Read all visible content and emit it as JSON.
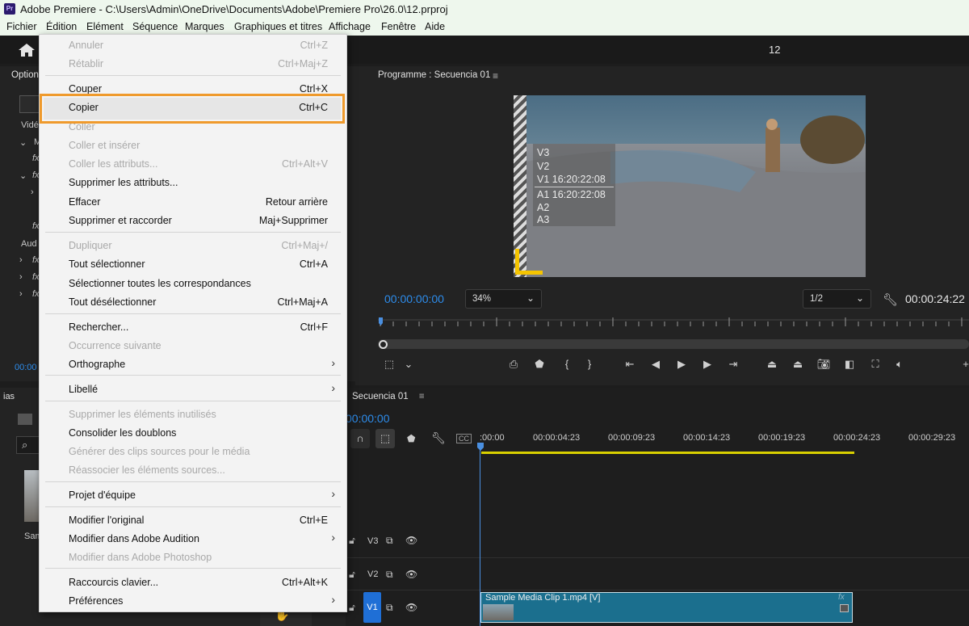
{
  "window": {
    "title": "Adobe Premiere - C:\\Users\\Admin\\OneDrive\\Documents\\Adobe\\Premiere Pro\\26.0\\12.prproj",
    "app_icon": "Pr"
  },
  "menubar": [
    "Fichier",
    "Édition",
    "Elément",
    "Séquence",
    "Marques",
    "Graphiques et titres",
    "Affichage",
    "Fenêtre",
    "Aide"
  ],
  "workspace": {
    "number": "12"
  },
  "left_panel": {
    "tab": "Option",
    "labels": [
      "Vidé",
      "M",
      "fx",
      "fx",
      "fx",
      "Aud",
      "fx",
      "fx",
      "fx"
    ],
    "timecode": "00:00",
    "bottom_tab": "ias",
    "bottom_label": "Sam"
  },
  "program_monitor": {
    "title": "Programme : Secuencia 01",
    "overlay": [
      "V3",
      "V2",
      "V1 16:20:22:08",
      "A1 16:20:22:08",
      "A2",
      "A3"
    ],
    "timecode_current": "00:00:00:00",
    "zoom": "34%",
    "resolution": "1/2",
    "timecode_duration": "00:00:24:22"
  },
  "timeline": {
    "tab": "Secuencia 01",
    "timecode": "00:00:00",
    "ruler": [
      ":00:00",
      "00:00:04:23",
      "00:00:09:23",
      "00:00:14:23",
      "00:00:19:23",
      "00:00:24:23",
      "00:00:29:23"
    ],
    "tracks": [
      "V3",
      "V2",
      "V1"
    ],
    "clip_name": "Sample Media Clip 1.mp4 [V]",
    "clip_fx": "fx"
  },
  "edit_menu": {
    "items": [
      {
        "label": "Annuler",
        "shortcut": "Ctrl+Z",
        "disabled": true
      },
      {
        "label": "Rétablir",
        "shortcut": "Ctrl+Maj+Z",
        "disabled": true
      },
      {
        "label": "Couper",
        "shortcut": "Ctrl+X",
        "disabled": false
      },
      {
        "label": "Copier",
        "shortcut": "Ctrl+C",
        "disabled": false
      },
      {
        "label": "Coller",
        "shortcut": "",
        "disabled": true
      },
      {
        "label": "Coller et insérer",
        "shortcut": "",
        "disabled": true
      },
      {
        "label": "Coller les attributs...",
        "shortcut": "Ctrl+Alt+V",
        "disabled": true
      },
      {
        "label": "Supprimer les attributs...",
        "shortcut": "",
        "disabled": false
      },
      {
        "label": "Effacer",
        "shortcut": "Retour arrière",
        "disabled": false
      },
      {
        "label": "Supprimer et raccorder",
        "shortcut": "Maj+Supprimer",
        "disabled": false
      },
      {
        "label": "Dupliquer",
        "shortcut": "Ctrl+Maj+/",
        "disabled": true
      },
      {
        "label": "Tout sélectionner",
        "shortcut": "Ctrl+A",
        "disabled": false
      },
      {
        "label": "Sélectionner toutes les correspondances",
        "shortcut": "",
        "disabled": false
      },
      {
        "label": "Tout désélectionner",
        "shortcut": "Ctrl+Maj+A",
        "disabled": false
      },
      {
        "label": "Rechercher...",
        "shortcut": "Ctrl+F",
        "disabled": false
      },
      {
        "label": "Occurrence suivante",
        "shortcut": "",
        "disabled": true
      },
      {
        "label": "Orthographe",
        "shortcut": "",
        "disabled": false,
        "submenu": true
      },
      {
        "label": "Libellé",
        "shortcut": "",
        "disabled": false,
        "submenu": true
      },
      {
        "label": "Supprimer les éléments inutilisés",
        "shortcut": "",
        "disabled": true
      },
      {
        "label": "Consolider les doublons",
        "shortcut": "",
        "disabled": false
      },
      {
        "label": "Générer des clips sources pour le média",
        "shortcut": "",
        "disabled": true
      },
      {
        "label": "Réassocier les éléments sources...",
        "shortcut": "",
        "disabled": true
      },
      {
        "label": "Projet d'équipe",
        "shortcut": "",
        "disabled": false,
        "submenu": true
      },
      {
        "label": "Modifier l'original",
        "shortcut": "Ctrl+E",
        "disabled": false
      },
      {
        "label": "Modifier dans Adobe Audition",
        "shortcut": "",
        "disabled": false,
        "submenu": true
      },
      {
        "label": "Modifier dans Adobe Photoshop",
        "shortcut": "",
        "disabled": true
      },
      {
        "label": "Raccourcis clavier...",
        "shortcut": "Ctrl+Alt+K",
        "disabled": false
      },
      {
        "label": "Préférences",
        "shortcut": "",
        "disabled": false,
        "submenu": true
      }
    ],
    "highlighted": "Copier",
    "highlight_color": "#ef9a2c"
  }
}
